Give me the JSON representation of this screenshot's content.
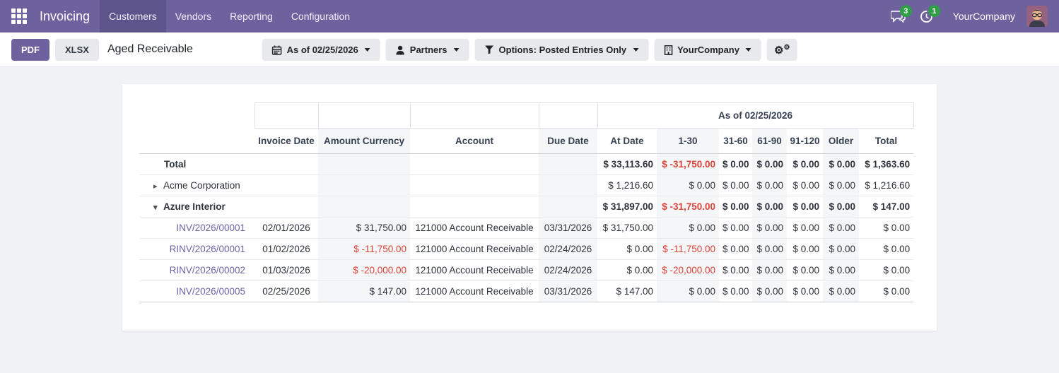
{
  "colors": {
    "purple": "#6d619e",
    "purple_dark": "#5d548b",
    "link": "#6c63a5",
    "danger": "#dd4238",
    "badge_green": "#2f9e44",
    "page_bg": "#f1f2f6",
    "border": "#dee2e6",
    "stripe": "#f5f6f8",
    "btn_gray": "#e7e9ed"
  },
  "navbar": {
    "apps_icon": "apps-grid-icon",
    "brand": "Invoicing",
    "menu_items": [
      {
        "label": "Customers",
        "active": true
      },
      {
        "label": "Vendors",
        "active": false
      },
      {
        "label": "Reporting",
        "active": false
      },
      {
        "label": "Configuration",
        "active": false
      }
    ],
    "messages_badge": "3",
    "activities_badge": "1",
    "company": "YourCompany"
  },
  "control_panel": {
    "pdf_label": "PDF",
    "xlsx_label": "XLSX",
    "title": "Aged Receivable",
    "filters": [
      {
        "icon": "calendar-icon",
        "label": "As of 02/25/2026"
      },
      {
        "icon": "user-icon",
        "label": "Partners"
      },
      {
        "icon": "filter-funnel-icon",
        "label": "Options: Posted Entries Only"
      },
      {
        "icon": "building-icon",
        "label": "YourCompany"
      }
    ],
    "cog_icon": "cogs-icon"
  },
  "report_table": {
    "period_header": "As of 02/25/2026",
    "columns": [
      "",
      "Invoice Date",
      "Amount Currency",
      "Account",
      "Due Date",
      "At Date",
      "1-30",
      "31-60",
      "61-90",
      "91-120",
      "Older",
      "Total"
    ],
    "rows": [
      {
        "type": "total",
        "name": "Total",
        "cells": [
          "",
          "",
          "",
          "",
          "$ 33,113.60",
          "$ -31,750.00",
          "$ 0.00",
          "$ 0.00",
          "$ 0.00",
          "$ 0.00",
          "$ 1,363.60"
        ],
        "red": [
          5
        ]
      },
      {
        "type": "partner-collapsed",
        "name": "Acme Corporation",
        "cells": [
          "",
          "",
          "",
          "",
          "$ 1,216.60",
          "$ 0.00",
          "$ 0.00",
          "$ 0.00",
          "$ 0.00",
          "$ 0.00",
          "$ 1,216.60"
        ],
        "red": []
      },
      {
        "type": "partner-expanded",
        "name": "Azure Interior",
        "cells": [
          "",
          "",
          "",
          "",
          "$ 31,897.00",
          "$ -31,750.00",
          "$ 0.00",
          "$ 0.00",
          "$ 0.00",
          "$ 0.00",
          "$ 147.00"
        ],
        "red": [
          5
        ]
      },
      {
        "type": "move-line",
        "name": "INV/2026/00001",
        "cells": [
          "02/01/2026",
          "$ 31,750.00",
          "121000 Account Receivable",
          "03/31/2026",
          "$ 31,750.00",
          "$ 0.00",
          "$ 0.00",
          "$ 0.00",
          "$ 0.00",
          "$ 0.00",
          "$ 0.00"
        ],
        "red": []
      },
      {
        "type": "move-line",
        "name": "RINV/2026/00001",
        "cells": [
          "01/02/2026",
          "$ -11,750.00",
          "121000 Account Receivable",
          "02/24/2026",
          "$ 0.00",
          "$ -11,750.00",
          "$ 0.00",
          "$ 0.00",
          "$ 0.00",
          "$ 0.00",
          "$ 0.00"
        ],
        "red": [
          1,
          5
        ]
      },
      {
        "type": "move-line",
        "name": "RINV/2026/00002",
        "cells": [
          "01/03/2026",
          "$ -20,000.00",
          "121000 Account Receivable",
          "02/24/2026",
          "$ 0.00",
          "$ -20,000.00",
          "$ 0.00",
          "$ 0.00",
          "$ 0.00",
          "$ 0.00",
          "$ 0.00"
        ],
        "red": [
          1,
          5
        ]
      },
      {
        "type": "move-line",
        "name": "INV/2026/00005",
        "cells": [
          "02/25/2026",
          "$ 147.00",
          "121000 Account Receivable",
          "03/31/2026",
          "$ 147.00",
          "$ 0.00",
          "$ 0.00",
          "$ 0.00",
          "$ 0.00",
          "$ 0.00",
          "$ 0.00"
        ],
        "red": []
      }
    ]
  }
}
